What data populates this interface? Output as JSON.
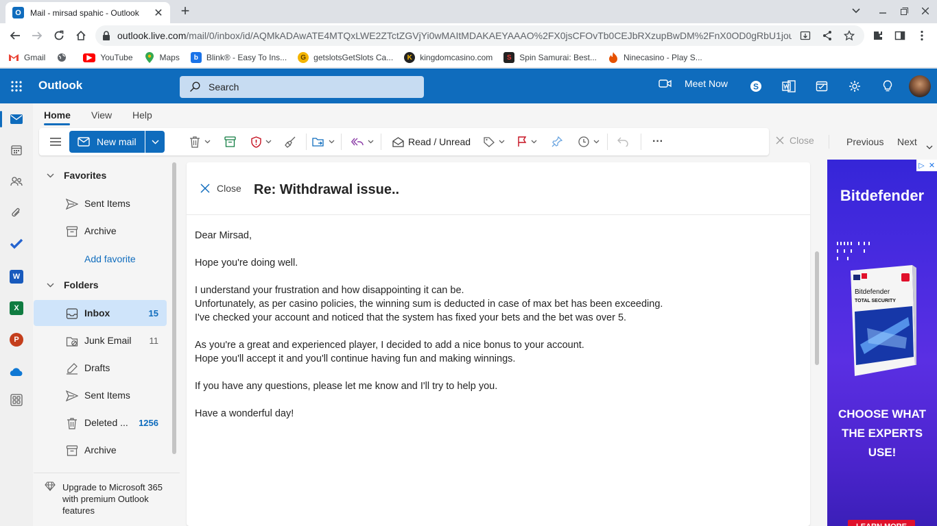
{
  "browser": {
    "tab_title": "Mail - mirsad spahic - Outlook",
    "url_host": "outlook.live.com",
    "url_path": "/mail/0/inbox/id/AQMkADAwATE4MTQxLWE2ZTctZGVjYi0wMAItMDAKAEYAAAO%2FX0jsCFOvTb0CEJbRXzupBwDM%2FnX0OD0gRbU1jou...",
    "bookmarks": [
      {
        "label": "Gmail",
        "icon": "gmail-icon",
        "color": "#ea4335"
      },
      {
        "label": "",
        "icon": "globe-icon",
        "color": "#5f6368"
      },
      {
        "label": "YouTube",
        "icon": "youtube-icon",
        "color": "#ff0000"
      },
      {
        "label": "Maps",
        "icon": "maps-pin-icon",
        "color": "#34a853"
      },
      {
        "label": "Blink® - Easy To Ins...",
        "icon": "blink-icon",
        "color": "#1a73e8"
      },
      {
        "label": "getslotsGetSlots Ca...",
        "icon": "getslots-icon",
        "color": "#f4b400"
      },
      {
        "label": "kingdomcasino.com",
        "icon": "kingdomcasino-icon",
        "color": "#222222"
      },
      {
        "label": "Spin Samurai: Best...",
        "icon": "spin-samurai-icon",
        "color": "#b71c1c"
      },
      {
        "label": "Ninecasino - Play S...",
        "icon": "ninecasino-icon",
        "color": "#e65100"
      }
    ]
  },
  "outlook": {
    "brand": "Outlook",
    "search_placeholder": "Search",
    "meet_now": "Meet Now",
    "accent": "#0f6cbd"
  },
  "ribbon": {
    "tabs": [
      "Home",
      "View",
      "Help"
    ],
    "new_mail": "New mail",
    "read_unread": "Read / Unread",
    "more": "···",
    "close": "Close",
    "previous": "Previous",
    "next": "Next"
  },
  "folders": {
    "favorites_label": "Favorites",
    "favorites": [
      {
        "name": "Sent Items",
        "icon": "send-icon"
      },
      {
        "name": "Archive",
        "icon": "archive-icon"
      }
    ],
    "add_favorite": "Add favorite",
    "folders_label": "Folders",
    "items": [
      {
        "name": "Inbox",
        "count": "15",
        "icon": "inbox-icon"
      },
      {
        "name": "Junk Email",
        "count": "11",
        "icon": "junk-icon"
      },
      {
        "name": "Drafts",
        "count": "",
        "icon": "drafts-pencil-icon"
      },
      {
        "name": "Sent Items",
        "count": "",
        "icon": "send-icon"
      },
      {
        "name": "Deleted ...",
        "count": "1256",
        "icon": "trash-icon"
      },
      {
        "name": "Archive",
        "count": "",
        "icon": "archive-icon"
      }
    ],
    "upgrade": "Upgrade to Microsoft 365 with premium Outlook features"
  },
  "message": {
    "close": "Close",
    "subject": "Re: Withdrawal issue..",
    "greeting": "Dear Mirsad,",
    "p1": "Hope you're doing well.",
    "p2a": "I understand your frustration and how disappointing it can be.",
    "p2b": "Unfortunately, as per casino policies, the winning sum is deducted in case of max bet has been exceeding.",
    "p2c": "I've checked your account and noticed that the system has fixed your bets and the bet was over 5.",
    "p3a": "As you're a great and experienced player, I decided to add a nice bonus to your account.",
    "p3b": "Hope you'll accept it and you'll continue having fun and making winnings.",
    "p4": "If you have any questions, please let me know and I'll try to help you.",
    "p5": "Have a wonderful day!"
  },
  "ad": {
    "brand": "Bitdefender",
    "cta": "CHOOSE WHAT THE EXPERTS USE!",
    "learn": "LEARN MORE",
    "product_brand": "Bitdefender",
    "product_name": "TOTAL SECURITY"
  }
}
